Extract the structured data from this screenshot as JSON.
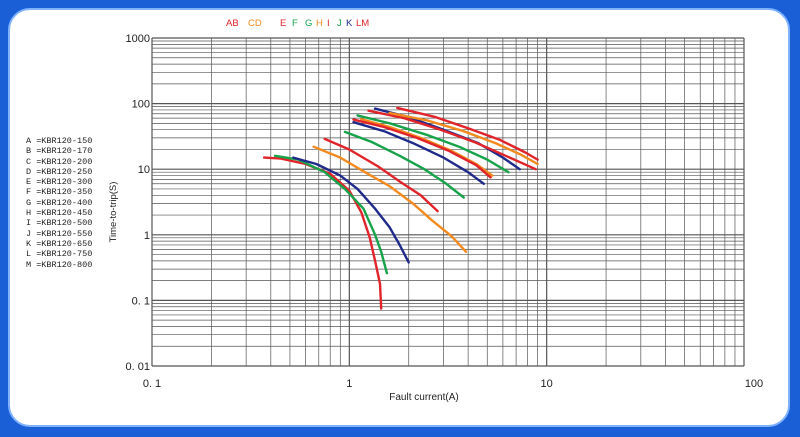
{
  "chart_data": {
    "type": "line",
    "xscale": "log",
    "yscale": "log",
    "xlim": [
      0.1,
      100
    ],
    "ylim": [
      0.01,
      1000
    ],
    "xlabel": "Fault current(A)",
    "ylabel": "Time-to-trip(S)",
    "x_ticks": [
      "0. 1",
      "1",
      "10",
      "100"
    ],
    "y_ticks": [
      "1000",
      "100",
      "10",
      "1",
      "0. 1",
      "0. 01"
    ],
    "top_letters": [
      {
        "text": "AB",
        "color": "#e0242a"
      },
      {
        "text": "CD",
        "color": "#f28a1e"
      },
      {
        "text": "E",
        "color": "#e0242a"
      },
      {
        "text": "F",
        "color": "#16a34a"
      },
      {
        "text": "G",
        "color": "#16a34a"
      },
      {
        "text": "H",
        "color": "#f28a1e"
      },
      {
        "text": "I",
        "color": "#e0242a"
      },
      {
        "text": "J",
        "color": "#16a34a"
      },
      {
        "text": "K",
        "color": "#1f2a8a"
      },
      {
        "text": "LM",
        "color": "#e0242a"
      }
    ],
    "legend": [
      "A =KBR120-150",
      "B =KBR120-170",
      "C =KBR120-200",
      "D =KBR120-250",
      "E =KBR120-300",
      "F =KBR120-350",
      "G =KBR120-400",
      "H =KBR120-450",
      "I =KBR120-500",
      "J =KBR120-550",
      "K =KBR120-650",
      "L =KBR120-750",
      "M =KBR120-800"
    ],
    "series": [
      {
        "color": "#e0242a",
        "points": [
          [
            0.37,
            15
          ],
          [
            0.45,
            14.5
          ],
          [
            0.6,
            12
          ],
          [
            0.8,
            8.5
          ],
          [
            1.0,
            4.7
          ],
          [
            1.15,
            2.2
          ],
          [
            1.27,
            0.9
          ],
          [
            1.35,
            0.4
          ],
          [
            1.43,
            0.18
          ],
          [
            1.45,
            0.075
          ]
        ]
      },
      {
        "color": "#16a34a",
        "points": [
          [
            0.42,
            16
          ],
          [
            0.55,
            14
          ],
          [
            0.75,
            9
          ],
          [
            0.95,
            5
          ],
          [
            1.18,
            2.5
          ],
          [
            1.35,
            1
          ],
          [
            1.45,
            0.55
          ],
          [
            1.55,
            0.26
          ]
        ]
      },
      {
        "color": "#1f2a8a",
        "points": [
          [
            0.52,
            15
          ],
          [
            0.68,
            12
          ],
          [
            0.9,
            8
          ],
          [
            1.1,
            5
          ],
          [
            1.35,
            2.5
          ],
          [
            1.6,
            1.3
          ],
          [
            1.8,
            0.7
          ],
          [
            2.0,
            0.38
          ]
        ]
      },
      {
        "color": "#f28a1e",
        "points": [
          [
            0.66,
            22
          ],
          [
            0.9,
            15
          ],
          [
            1.2,
            9
          ],
          [
            1.6,
            5.5
          ],
          [
            2.1,
            3
          ],
          [
            2.6,
            1.7
          ],
          [
            3.3,
            0.95
          ],
          [
            3.9,
            0.55
          ]
        ]
      },
      {
        "color": "#e0242a",
        "points": [
          [
            0.75,
            29
          ],
          [
            1.0,
            20
          ],
          [
            1.4,
            11
          ],
          [
            1.8,
            6.5
          ],
          [
            2.3,
            4
          ],
          [
            2.8,
            2.3
          ]
        ]
      },
      {
        "color": "#16a34a",
        "points": [
          [
            0.95,
            37
          ],
          [
            1.3,
            26
          ],
          [
            1.8,
            16
          ],
          [
            2.4,
            10
          ],
          [
            3.1,
            6
          ],
          [
            3.8,
            3.7
          ]
        ]
      },
      {
        "color": "#1f2a8a",
        "points": [
          [
            1.05,
            52
          ],
          [
            1.5,
            38
          ],
          [
            2.1,
            25
          ],
          [
            3.0,
            15
          ],
          [
            4.0,
            9
          ],
          [
            4.8,
            6
          ]
        ]
      },
      {
        "color": "#f28a1e",
        "points": [
          [
            1.15,
            58
          ],
          [
            1.6,
            44
          ],
          [
            2.3,
            30
          ],
          [
            3.3,
            19
          ],
          [
            4.4,
            12
          ],
          [
            5.3,
            8
          ]
        ]
      },
      {
        "color": "#e0242a",
        "points": [
          [
            1.05,
            57
          ],
          [
            1.5,
            44
          ],
          [
            2.2,
            30
          ],
          [
            3.2,
            19
          ],
          [
            4.4,
            11.5
          ],
          [
            5.2,
            7.5
          ]
        ]
      },
      {
        "color": "#16a34a",
        "points": [
          [
            1.1,
            66
          ],
          [
            1.6,
            50
          ],
          [
            2.5,
            33
          ],
          [
            3.6,
            22
          ],
          [
            5.0,
            14
          ],
          [
            6.4,
            9
          ]
        ]
      },
      {
        "color": "#1f2a8a",
        "points": [
          [
            1.35,
            84
          ],
          [
            2.0,
            62
          ],
          [
            3.0,
            40
          ],
          [
            4.5,
            25
          ],
          [
            6.0,
            15
          ],
          [
            7.3,
            10
          ]
        ]
      },
      {
        "color": "#e0242a",
        "points": [
          [
            1.25,
            78
          ],
          [
            1.9,
            60
          ],
          [
            2.9,
            40
          ],
          [
            4.3,
            26
          ],
          [
            6.2,
            16
          ],
          [
            8.8,
            10
          ]
        ]
      },
      {
        "color": "#e0242a",
        "points": [
          [
            1.75,
            86
          ],
          [
            2.7,
            63
          ],
          [
            4.0,
            42
          ],
          [
            5.8,
            28
          ],
          [
            7.8,
            18
          ],
          [
            9.0,
            14
          ]
        ]
      },
      {
        "color": "#f28a1e",
        "points": [
          [
            1.6,
            72
          ],
          [
            2.5,
            55
          ],
          [
            3.8,
            38
          ],
          [
            5.5,
            25
          ],
          [
            7.3,
            17
          ],
          [
            9.0,
            12
          ]
        ]
      }
    ]
  }
}
